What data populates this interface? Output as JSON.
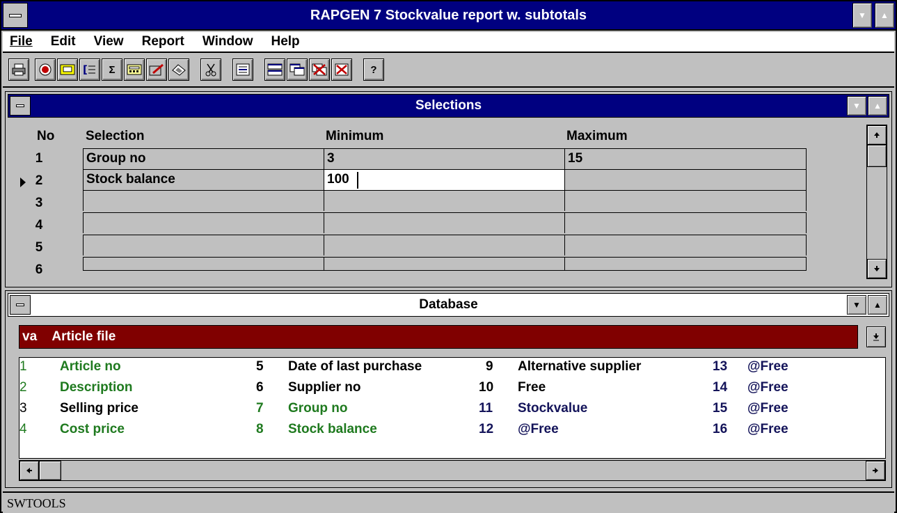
{
  "app": {
    "title": "RAPGEN 7 Stockvalue report w. subtotals"
  },
  "menu": [
    {
      "label": "File"
    },
    {
      "label": "Edit"
    },
    {
      "label": "View"
    },
    {
      "label": "Report"
    },
    {
      "label": "Window"
    },
    {
      "label": "Help"
    }
  ],
  "toolbar": {
    "buttons": [
      {
        "icon": "print-icon"
      },
      {
        "icon": "record-icon"
      },
      {
        "icon": "label-icon"
      },
      {
        "icon": "list-icon"
      },
      {
        "icon": "sigma-icon",
        "glyph": "Σ"
      },
      {
        "icon": "calculator-icon"
      },
      {
        "icon": "edit-doc-icon"
      },
      {
        "icon": "eraser-icon"
      },
      {
        "icon": "scissors-icon"
      },
      {
        "icon": "text-format-icon"
      },
      {
        "icon": "tile-icon"
      },
      {
        "icon": "cascade-icon"
      },
      {
        "icon": "close-all-icon"
      },
      {
        "icon": "close-window-icon"
      },
      {
        "icon": "help-icon",
        "glyph": "?"
      }
    ]
  },
  "selections": {
    "title": "Selections",
    "headers": {
      "no": "No",
      "selection": "Selection",
      "minimum": "Minimum",
      "maximum": "Maximum"
    },
    "rows": [
      {
        "no": "1",
        "selection": "Group no",
        "minimum": "3",
        "maximum": "15"
      },
      {
        "no": "2",
        "selection": "Stock balance",
        "minimum": "100",
        "maximum": ""
      },
      {
        "no": "3",
        "selection": "",
        "minimum": "",
        "maximum": ""
      },
      {
        "no": "4",
        "selection": "",
        "minimum": "",
        "maximum": ""
      },
      {
        "no": "5",
        "selection": "",
        "minimum": "",
        "maximum": ""
      },
      {
        "no": "6",
        "selection": "",
        "minimum": "",
        "maximum": ""
      }
    ]
  },
  "database": {
    "title": "Database",
    "file_prefix": "va",
    "file_name": "Article file",
    "fields": [
      {
        "num": "1",
        "name": "Article no",
        "color": "#1f7a1f"
      },
      {
        "num": "2",
        "name": "Description",
        "color": "#1f7a1f"
      },
      {
        "num": "3",
        "name": "Selling price",
        "color": "#000000"
      },
      {
        "num": "4",
        "name": "Cost price",
        "color": "#1f7a1f"
      },
      {
        "num": "5",
        "name": "Date of last purchase",
        "color": "#000000"
      },
      {
        "num": "6",
        "name": "Supplier no",
        "color": "#000000"
      },
      {
        "num": "7",
        "name": "Group no",
        "color": "#1f7a1f"
      },
      {
        "num": "8",
        "name": "Stock balance",
        "color": "#1f7a1f"
      },
      {
        "num": "9",
        "name": "Alternative supplier",
        "color": "#000000"
      },
      {
        "num": "10",
        "name": "Free",
        "color": "#000000"
      },
      {
        "num": "11",
        "name": "Stockvalue",
        "color": "#14145a"
      },
      {
        "num": "12",
        "name": "@Free",
        "color": "#14145a"
      },
      {
        "num": "13",
        "name": "@Free",
        "color": "#14145a"
      },
      {
        "num": "14",
        "name": "@Free",
        "color": "#14145a"
      },
      {
        "num": "15",
        "name": "@Free",
        "color": "#14145a"
      },
      {
        "num": "16",
        "name": "@Free",
        "color": "#14145a"
      }
    ]
  },
  "status": {
    "text": "SWTOOLS"
  },
  "colors": {
    "titlebar_active": "#000080",
    "file_bar": "#800000"
  }
}
